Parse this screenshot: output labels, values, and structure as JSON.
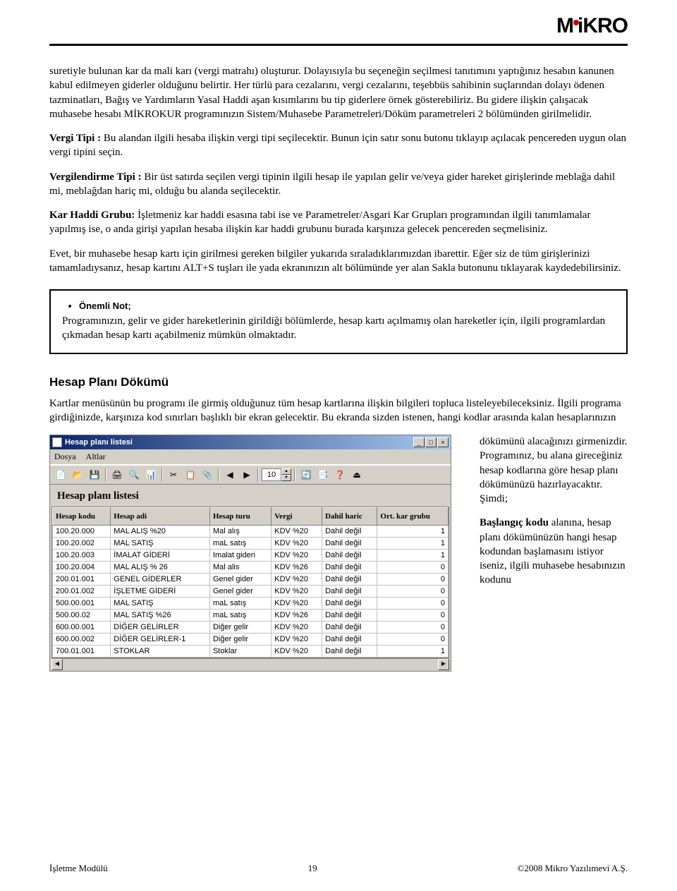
{
  "logo_text": "MiKRO",
  "paragraphs": {
    "p1": "suretiyle bulunan kar da mali karı (vergi matrahı) oluşturur. Dolayısıyla bu seçeneğin seçilmesi tanıtımını yaptığınız hesabın kanunen kabul edilmeyen giderler olduğunu belirtir. Her türlü para cezalarını, vergi cezalarını, teşebbüs sahibinin suçlarından dolayı ödenen tazminatları, Bağış ve Yardımların Yasal Haddi aşan kısımlarını bu tip giderlere örnek gösterebiliriz. Bu gidere ilişkin çalışacak muhasebe hesabı MİKROKUR programınızın Sistem/Muhasebe Parametreleri/Döküm parametreleri 2 bölümünden girilmelidir.",
    "p2_label": "Vergi Tipi :",
    "p2_text": " Bu alandan ilgili hesaba ilişkin vergi tipi seçilecektir. Bunun için satır sonu butonu tıklayıp açılacak pencereden uygun olan vergi tipini seçin.",
    "p3_label": "Vergilendirme Tipi :",
    "p3_text": " Bir üst satırda seçilen vergi tipinin ilgili hesap ile yapılan gelir ve/veya gider hareket girişlerinde meblağa dahil mi, meblağdan hariç mi,  olduğu bu alanda seçilecektir.",
    "p4_label": "Kar Haddi Grubu:",
    "p4_text": "  İşletmeniz kar haddi esasına tabi ise ve Parametreler/Asgari Kar Grupları programından ilgili tanımlamalar yapılmış ise, o anda girişi yapılan hesaba ilişkin kar haddi grubunu burada karşınıza gelecek pencereden seçmelisiniz.",
    "p5": "Evet, bir muhasebe hesap kartı için girilmesi gereken bilgiler yukarıda sıraladıklarımızdan ibarettir. Eğer siz de tüm girişlerinizi tamamladıysanız, hesap kartını ALT+S tuşları ile yada ekranınızın alt bölümünde yer alan Sakla butonunu tıklayarak kaydedebilirsiniz.",
    "note_title": "Önemli Not;",
    "note_body": "Programınızın, gelir ve gider hareketlerinin girildiği bölümlerde, hesap kartı açılmamış olan hareketler için, ilgili programlardan çıkmadan hesap kartı açabilmeniz mümkün olmaktadır.",
    "h2": "Hesap Planı Dökümü",
    "p6": "Kartlar menüsünün bu programı ile girmiş olduğunuz tüm hesap kartlarına ilişkin bilgileri topluca listeleyebileceksiniz. İlgili programa girdiğinizde, karşınıza kod sınırları başlıklı bir ekran gelecektir. Bu ekranda sizden istenen, hangi kodlar arasında kalan hesaplarınızın",
    "right1": "dökümünü alacağınızı girmenizdir. Programınız, bu alana gireceğiniz hesap kodlarına göre hesap planı dökümünüzü hazırlayacaktır. Şimdi;",
    "right2_label": "Başlangıç kodu",
    "right2_text": " alanına, hesap planı dökümünüzün hangi hesap kodundan başlamasını istiyor iseniz, ilgili muhasebe hesabınızın kodunu"
  },
  "window": {
    "title": "Hesap planı listesi",
    "menu": [
      "Dosya",
      "Altlar"
    ],
    "spin_value": "10",
    "list_title": "Hesap planı listesi",
    "columns": [
      "Hesap kodu",
      "Hesap adi",
      "Hesap turu",
      "Vergi",
      "Dahil haric",
      "Ort. kar grubu"
    ],
    "rows": [
      [
        "100.20.000",
        "MAL ALIŞ %20",
        "Mal alış",
        "KDV %20",
        "Dahil değil",
        "1"
      ],
      [
        "100.20.002",
        "MAL SATIŞ",
        "maL satış",
        "KDV %20",
        "Dahil değil",
        "1"
      ],
      [
        "100.20.003",
        "İMALAT GİDERİ",
        "Imalat gideri",
        "KDV %20",
        "Dahil değil",
        "1"
      ],
      [
        "100.20.004",
        "MAL ALIŞ % 26",
        "Mal alis",
        "KDV %26",
        "Dahil değil",
        "0"
      ],
      [
        "200.01.001",
        "GENEL GİDERLER",
        "Genel gider",
        "KDV %20",
        "Dahil değil",
        "0"
      ],
      [
        "200.01.002",
        "İŞLETME GİDERİ",
        "Genel gider",
        "KDV %20",
        "Dahil değil",
        "0"
      ],
      [
        "500.00.001",
        "MAL SATIŞ",
        "maL satış",
        "KDV %20",
        "Dahil değil",
        "0"
      ],
      [
        "500.00.02",
        "MAL SATIŞ %26",
        "maL satış",
        "KDV %26",
        "Dahil değil",
        "0"
      ],
      [
        "600.00.001",
        "DİĞER GELİRLER",
        "Diğer gelir",
        "KDV %20",
        "Dahil değil",
        "0"
      ],
      [
        "600.00.002",
        "DİĞER GELİRLER-1",
        "Diğer gelir",
        "KDV %20",
        "Dahil değil",
        "0"
      ],
      [
        "700.01.001",
        "STOKLAR",
        "Stoklar",
        "KDV %20",
        "Dahil değil",
        "1"
      ]
    ]
  },
  "footer": {
    "left": "İşletme Modülü",
    "center": "19",
    "right": "©2008 Mikro Yazılımevi A.Ş."
  }
}
